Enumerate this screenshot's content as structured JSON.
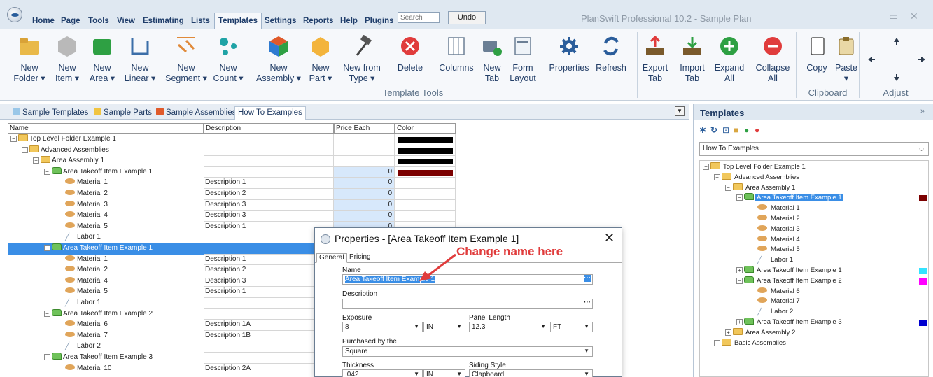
{
  "menubar": {
    "items": [
      "Home",
      "Page",
      "Tools",
      "View",
      "Estimating",
      "Lists",
      "Templates",
      "Settings",
      "Reports",
      "Help",
      "Plugins"
    ],
    "active": "Templates",
    "search_placeholder": "Search",
    "undo_label": "Undo",
    "app_title": "PlanSwift Professional 10.2 - Sample Plan"
  },
  "ribbon": {
    "buttons": [
      {
        "line1": "New",
        "line2": "Folder ▾",
        "icon": "folder-icon"
      },
      {
        "line1": "New",
        "line2": "Item ▾",
        "icon": "item-icon"
      },
      {
        "line1": "New",
        "line2": "Area ▾",
        "icon": "area-icon"
      },
      {
        "line1": "New",
        "line2": "Linear ▾",
        "icon": "linear-icon"
      },
      {
        "line1": "New",
        "line2": "Segment ▾",
        "icon": "segment-icon"
      },
      {
        "line1": "New",
        "line2": "Count ▾",
        "icon": "count-icon"
      },
      {
        "line1": "New",
        "line2": "Assembly ▾",
        "icon": "assembly-icon"
      },
      {
        "line1": "New",
        "line2": "Part ▾",
        "icon": "part-icon"
      },
      {
        "line1": "New from",
        "line2": "Type ▾",
        "icon": "hammer-icon"
      },
      {
        "line1": "Delete",
        "line2": "",
        "icon": "delete-icon"
      },
      {
        "line1": "Columns",
        "line2": "",
        "icon": "columns-icon"
      },
      {
        "line1": "New",
        "line2": "Tab",
        "icon": "new-tab-icon"
      },
      {
        "line1": "Form",
        "line2": "Layout",
        "icon": "form-layout-icon"
      },
      {
        "line1": "Properties",
        "line2": "",
        "icon": "gear-icon"
      },
      {
        "line1": "Refresh",
        "line2": "",
        "icon": "refresh-icon"
      },
      {
        "line1": "Export",
        "line2": "Tab",
        "icon": "export-icon"
      },
      {
        "line1": "Import",
        "line2": "Tab",
        "icon": "import-icon"
      },
      {
        "line1": "Expand",
        "line2": "All",
        "icon": "expand-icon"
      },
      {
        "line1": "Collapse",
        "line2": "All",
        "icon": "collapse-icon"
      },
      {
        "line1": "Copy",
        "line2": "",
        "icon": "copy-icon"
      },
      {
        "line1": "Paste",
        "line2": "▾",
        "icon": "paste-icon"
      }
    ],
    "group_labels": {
      "template_tools": "Template Tools",
      "clipboard": "Clipboard",
      "adjust": "Adjust"
    }
  },
  "tabs": [
    {
      "label": "Sample Templates",
      "icon": "templates-icon"
    },
    {
      "label": "Sample Parts",
      "icon": "parts-icon"
    },
    {
      "label": "Sample Assemblies",
      "icon": "assemblies-icon"
    },
    {
      "label": "How To Examples",
      "icon": ""
    }
  ],
  "grid": {
    "columns": [
      "Name",
      "Description",
      "Price Each",
      "Color"
    ],
    "rows": [
      {
        "name": "Top Level Folder Example 1",
        "type": "folder",
        "level": 0,
        "exp": "−",
        "desc": "",
        "price": "",
        "color": "#000000"
      },
      {
        "name": "Advanced Assemblies",
        "type": "folder",
        "level": 1,
        "exp": "−",
        "desc": "",
        "price": "",
        "color": "#000000"
      },
      {
        "name": "Area Assembly 1",
        "type": "folder",
        "level": 2,
        "exp": "−",
        "desc": "",
        "price": "",
        "color": "#000000"
      },
      {
        "name": "Area Takeoff Item Example 1",
        "type": "item",
        "level": 3,
        "exp": "−",
        "desc": "",
        "price": "0",
        "color": "#7b0000"
      },
      {
        "name": "Material 1",
        "type": "material",
        "level": 4,
        "exp": "",
        "desc": "Description 1",
        "price": "0",
        "color": ""
      },
      {
        "name": "Material 2",
        "type": "material",
        "level": 4,
        "exp": "",
        "desc": "Description 2",
        "price": "0",
        "color": ""
      },
      {
        "name": "Material 3",
        "type": "material",
        "level": 4,
        "exp": "",
        "desc": "Description 3",
        "price": "0",
        "color": ""
      },
      {
        "name": "Material 4",
        "type": "material",
        "level": 4,
        "exp": "",
        "desc": "Description 3",
        "price": "0",
        "color": ""
      },
      {
        "name": "Material 5",
        "type": "material",
        "level": 4,
        "exp": "",
        "desc": "Description 1",
        "price": "0",
        "color": ""
      },
      {
        "name": "Labor 1",
        "type": "labor",
        "level": 4,
        "exp": "",
        "desc": "",
        "price": "",
        "color": ""
      },
      {
        "name": "Area Takeoff Item Example 1",
        "type": "item",
        "level": 3,
        "exp": "−",
        "desc": "",
        "price": "",
        "color": "",
        "selected": true
      },
      {
        "name": "Material 1",
        "type": "material",
        "level": 4,
        "exp": "",
        "desc": "Description 1",
        "price": "",
        "color": ""
      },
      {
        "name": "Material 2",
        "type": "material",
        "level": 4,
        "exp": "",
        "desc": "Description 2",
        "price": "",
        "color": ""
      },
      {
        "name": "Material 4",
        "type": "material",
        "level": 4,
        "exp": "",
        "desc": "Description 3",
        "price": "",
        "color": ""
      },
      {
        "name": "Material 5",
        "type": "material",
        "level": 4,
        "exp": "",
        "desc": "Description 1",
        "price": "",
        "color": ""
      },
      {
        "name": "Labor 1",
        "type": "labor",
        "level": 4,
        "exp": "",
        "desc": "",
        "price": "",
        "color": ""
      },
      {
        "name": "Area Takeoff Item Example 2",
        "type": "item",
        "level": 3,
        "exp": "−",
        "desc": "",
        "price": "",
        "color": ""
      },
      {
        "name": "Material 6",
        "type": "material",
        "level": 4,
        "exp": "",
        "desc": "Description 1A",
        "price": "",
        "color": ""
      },
      {
        "name": "Material 7",
        "type": "material",
        "level": 4,
        "exp": "",
        "desc": "Description 1B",
        "price": "",
        "color": ""
      },
      {
        "name": "Labor 2",
        "type": "labor",
        "level": 4,
        "exp": "",
        "desc": "",
        "price": "",
        "color": ""
      },
      {
        "name": "Area Takeoff Item Example 3",
        "type": "item",
        "level": 3,
        "exp": "−",
        "desc": "",
        "price": "",
        "color": ""
      },
      {
        "name": "Material 10",
        "type": "material",
        "level": 4,
        "exp": "",
        "desc": "Description 2A",
        "price": "",
        "color": ""
      }
    ]
  },
  "dialog": {
    "title": "Properties - [Area Takeoff Item Example 1]",
    "tabs": [
      "General",
      "Pricing"
    ],
    "name_label": "Name",
    "name_value": "Area Takeoff Item Example 1",
    "description_label": "Description",
    "description_value": "",
    "exposure_label": "Exposure",
    "exposure_value": "8",
    "exposure_unit": "IN",
    "panel_length_label": "Panel Length",
    "panel_length_value": "12.3",
    "panel_length_unit": "FT",
    "purchased_label": "Purchased by the",
    "purchased_value": "Square",
    "thickness_label": "Thickness",
    "thickness_value": ".042",
    "thickness_unit": "IN",
    "siding_label": "Siding Style",
    "siding_value": "Clapboard",
    "ellipsis": "···"
  },
  "annotation": {
    "text": "Change name here",
    "color": "#e03c3c"
  },
  "right_panel": {
    "title": "Templates",
    "selector_value": "How To Examples",
    "tree": [
      {
        "name": "Top Level Folder Example 1",
        "type": "folder",
        "level": 0,
        "exp": "−",
        "color": ""
      },
      {
        "name": "Advanced Assemblies",
        "type": "folder",
        "level": 1,
        "exp": "−",
        "color": ""
      },
      {
        "name": "Area Assembly 1",
        "type": "folder",
        "level": 2,
        "exp": "−",
        "color": ""
      },
      {
        "name": "Area Takeoff Item Example 1",
        "type": "item",
        "level": 3,
        "exp": "−",
        "color": "#7b0000",
        "selected": true
      },
      {
        "name": "Material 1",
        "type": "material",
        "level": 4,
        "exp": "",
        "color": ""
      },
      {
        "name": "Material 2",
        "type": "material",
        "level": 4,
        "exp": "",
        "color": ""
      },
      {
        "name": "Material 3",
        "type": "material",
        "level": 4,
        "exp": "",
        "color": ""
      },
      {
        "name": "Material 4",
        "type": "material",
        "level": 4,
        "exp": "",
        "color": ""
      },
      {
        "name": "Material 5",
        "type": "material",
        "level": 4,
        "exp": "",
        "color": ""
      },
      {
        "name": "Labor 1",
        "type": "labor",
        "level": 4,
        "exp": "",
        "color": ""
      },
      {
        "name": "Area Takeoff Item Example 1",
        "type": "item",
        "level": 3,
        "exp": "+",
        "color": "#33e3ff"
      },
      {
        "name": "Area Takeoff Item Example 2",
        "type": "item",
        "level": 3,
        "exp": "−",
        "color": "#ff00ff"
      },
      {
        "name": "Material 6",
        "type": "material",
        "level": 4,
        "exp": "",
        "color": ""
      },
      {
        "name": "Material 7",
        "type": "material",
        "level": 4,
        "exp": "",
        "color": ""
      },
      {
        "name": "Labor 2",
        "type": "labor",
        "level": 4,
        "exp": "",
        "color": ""
      },
      {
        "name": "Area Takeoff Item Example 3",
        "type": "item",
        "level": 3,
        "exp": "+",
        "color": "#0000d0"
      },
      {
        "name": "Area Assembly 2",
        "type": "folder",
        "level": 2,
        "exp": "+",
        "color": ""
      },
      {
        "name": "Basic Assemblies",
        "type": "folder",
        "level": 1,
        "exp": "+",
        "color": ""
      }
    ]
  },
  "colors": {
    "accent": "#3a8ee6",
    "ribbon_text": "#243f68",
    "menubar_bg": "#dfe8f1"
  }
}
